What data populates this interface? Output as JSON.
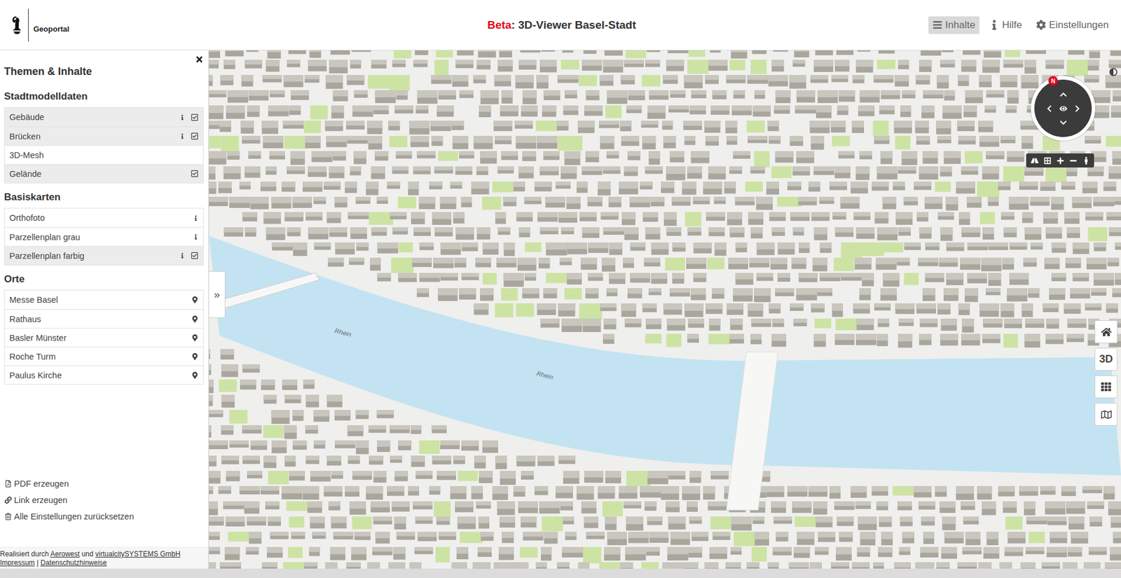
{
  "header": {
    "logo_text": "Geoportal",
    "title_prefix": "Beta",
    "title": ": 3D-Viewer Basel-Stadt",
    "nav": [
      {
        "label": "Inhalte",
        "selected": true,
        "kind": "menu"
      },
      {
        "label": "Hilfe",
        "selected": false,
        "kind": "help"
      },
      {
        "label": "Einstellungen",
        "selected": false,
        "kind": "settings"
      }
    ]
  },
  "sidebar": {
    "title": "Themen & Inhalte",
    "sections": [
      {
        "title": "Stadtmodelldaten",
        "items": [
          {
            "label": "Gebäude",
            "kind": "layer",
            "info": true,
            "checked": true
          },
          {
            "label": "Brücken",
            "kind": "layer",
            "info": true,
            "checked": true
          },
          {
            "label": "3D-Mesh",
            "kind": "layer",
            "info": false,
            "checked": false
          },
          {
            "label": "Gelände",
            "kind": "layer",
            "info": false,
            "checked": true
          }
        ]
      },
      {
        "title": "Basiskarten",
        "items": [
          {
            "label": "Orthofoto",
            "kind": "layer",
            "info": true,
            "checked": false
          },
          {
            "label": "Parzellenplan grau",
            "kind": "layer",
            "info": true,
            "checked": false
          },
          {
            "label": "Parzellenplan farbig",
            "kind": "layer",
            "info": true,
            "checked": true
          }
        ]
      },
      {
        "title": "Orte",
        "items": [
          {
            "label": "Messe Basel",
            "kind": "place",
            "info": false,
            "checked": false
          },
          {
            "label": "Rathaus",
            "kind": "place",
            "info": false,
            "checked": false
          },
          {
            "label": "Basler Münster",
            "kind": "place",
            "info": false,
            "checked": false
          },
          {
            "label": "Roche Turm",
            "kind": "place",
            "info": false,
            "checked": false
          },
          {
            "label": "Paulus Kirche",
            "kind": "place",
            "info": false,
            "checked": false
          }
        ]
      }
    ],
    "actions": [
      {
        "label": "PDF erzeugen",
        "kind": "pdf"
      },
      {
        "label": "Link erzeugen",
        "kind": "link"
      },
      {
        "label": "Alle Einstellungen zurücksetzen",
        "kind": "reset"
      }
    ]
  },
  "footer": {
    "lines": [
      [
        {
          "text": "Realisiert durch ",
          "link": false
        },
        {
          "text": "Aerowest",
          "link": true
        },
        {
          "text": " und ",
          "link": false
        },
        {
          "text": "virtualcitySYSTEMS GmbH",
          "link": true
        }
      ],
      [
        {
          "text": "Impressum",
          "link": true
        },
        {
          "text": " | ",
          "link": false
        },
        {
          "text": "Datenschutzhinweise",
          "link": true
        }
      ]
    ]
  },
  "map": {
    "toggle": "»",
    "labels": [
      "Rhein",
      "Rhein"
    ],
    "compass_north": "N",
    "side_buttons": [
      {
        "kind": "home",
        "label": ""
      },
      {
        "kind": "mode",
        "label": "3D"
      },
      {
        "kind": "grid",
        "label": ""
      },
      {
        "kind": "map",
        "label": ""
      }
    ]
  }
}
